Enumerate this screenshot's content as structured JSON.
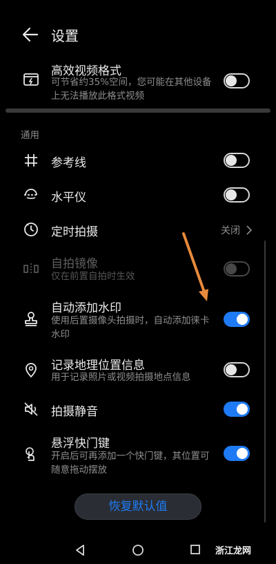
{
  "header": {
    "title": "设置"
  },
  "video_format": {
    "label": "高效视频格式",
    "desc": "可节省约35%空间，您可能在其他设备上无法播放此格式视频",
    "on": false
  },
  "section_general": "通用",
  "items": [
    {
      "label": "参考线",
      "on": false,
      "icon": "grid-icon"
    },
    {
      "label": "水平仪",
      "on": false,
      "icon": "level-icon"
    },
    {
      "label": "定时拍摄",
      "value": "关闭",
      "icon": "timer-icon"
    },
    {
      "label": "自拍镜像",
      "desc": "仅在前置自拍时生效",
      "on": false,
      "disabled": true,
      "icon": "mirror-icon"
    },
    {
      "label": "自动添加水印",
      "desc": "使用后置摄像头拍摄时，自动添加徕卡水印",
      "on": true,
      "icon": "stamp-icon"
    },
    {
      "label": "记录地理位置信息",
      "desc": "用于记录照片或视频拍摄地点信息",
      "on": false,
      "icon": "location-icon"
    },
    {
      "label": "拍摄静音",
      "on": true,
      "icon": "mute-icon"
    },
    {
      "label": "悬浮快门键",
      "desc": "开启后可再添加一个快门键，其位置可随意拖动摆放",
      "on": true,
      "icon": "float-shutter-icon"
    }
  ],
  "reset_button": "恢复默认值",
  "watermark": "浙江龙网",
  "colors": {
    "accent": "#1f7bf5",
    "background": "#000000",
    "annotation_arrow": "#e88a3c"
  }
}
